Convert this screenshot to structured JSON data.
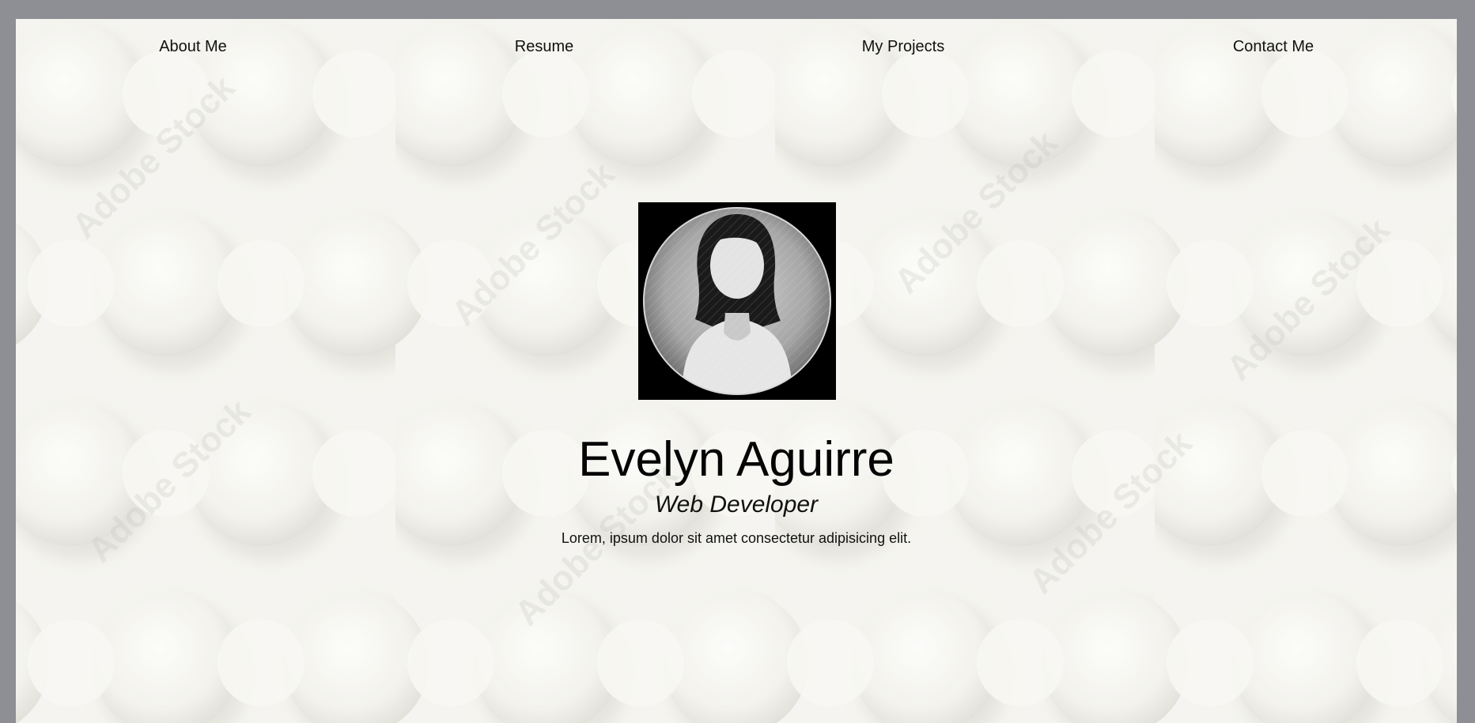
{
  "nav": {
    "items": [
      {
        "label": "About Me"
      },
      {
        "label": "Resume"
      },
      {
        "label": "My Projects"
      },
      {
        "label": "Contact Me"
      }
    ]
  },
  "hero": {
    "name": "Evelyn Aguirre",
    "role": "Web Developer",
    "tagline": "Lorem, ipsum dolor sit amet consectetur adipisicing elit.",
    "avatar_icon": "female-avatar-icon"
  },
  "background": {
    "watermark_text": "Adobe Stock"
  },
  "colors": {
    "frame": "#8e8f94",
    "page_background": "#f1f0ea",
    "text": "#111111"
  }
}
